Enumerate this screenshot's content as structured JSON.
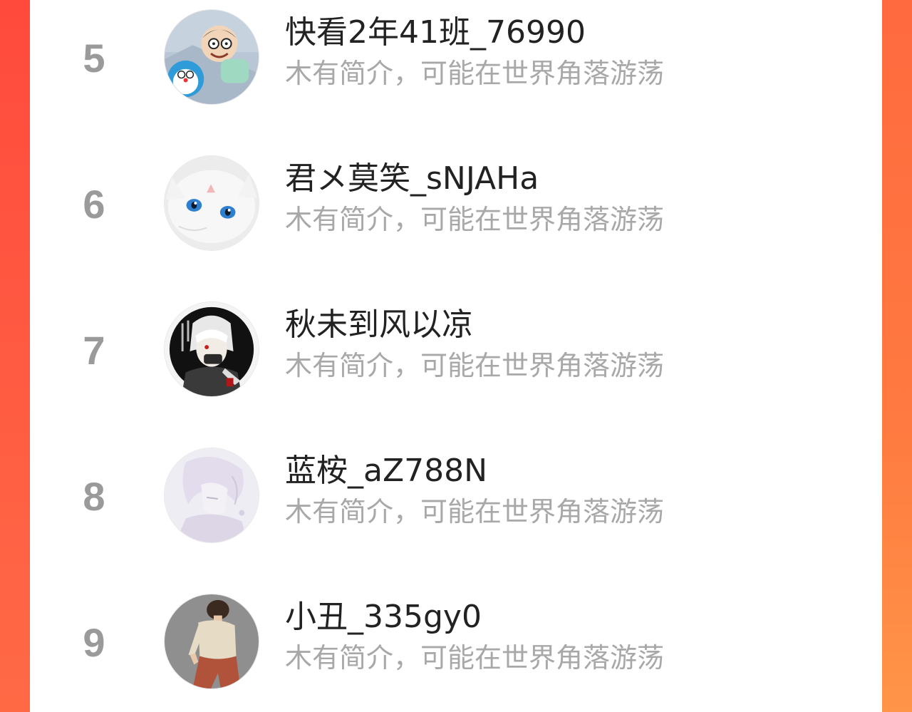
{
  "colors": {
    "frame_left": "#ff4a3c",
    "frame_right": "#ff7a40",
    "card_bg": "#ffffff",
    "rank_color": "#9a9a9a",
    "name_color": "#222222",
    "bio_color": "#a8a8a8"
  },
  "list": {
    "items": [
      {
        "rank": "5",
        "name": "快看2年41班_76990",
        "bio": "木有简介，可能在世界角落游荡",
        "avatar_icon": "cartoon-boy-avatar"
      },
      {
        "rank": "6",
        "name": "君メ莫笑_sNJAHa",
        "bio": "木有简介，可能在世界角落游荡",
        "avatar_icon": "white-cat-avatar"
      },
      {
        "rank": "7",
        "name": "秋未到风以凉",
        "bio": "木有简介，可能在世界角落游荡",
        "avatar_icon": "anime-character-avatar"
      },
      {
        "rank": "8",
        "name": "蓝桉_aZ788N",
        "bio": "木有简介，可能在世界角落游荡",
        "avatar_icon": "pastel-anime-avatar"
      },
      {
        "rank": "9",
        "name": "小丑_335gy0",
        "bio": "木有简介，可能在世界角落游荡",
        "avatar_icon": "cartoon-man-avatar"
      }
    ]
  }
}
